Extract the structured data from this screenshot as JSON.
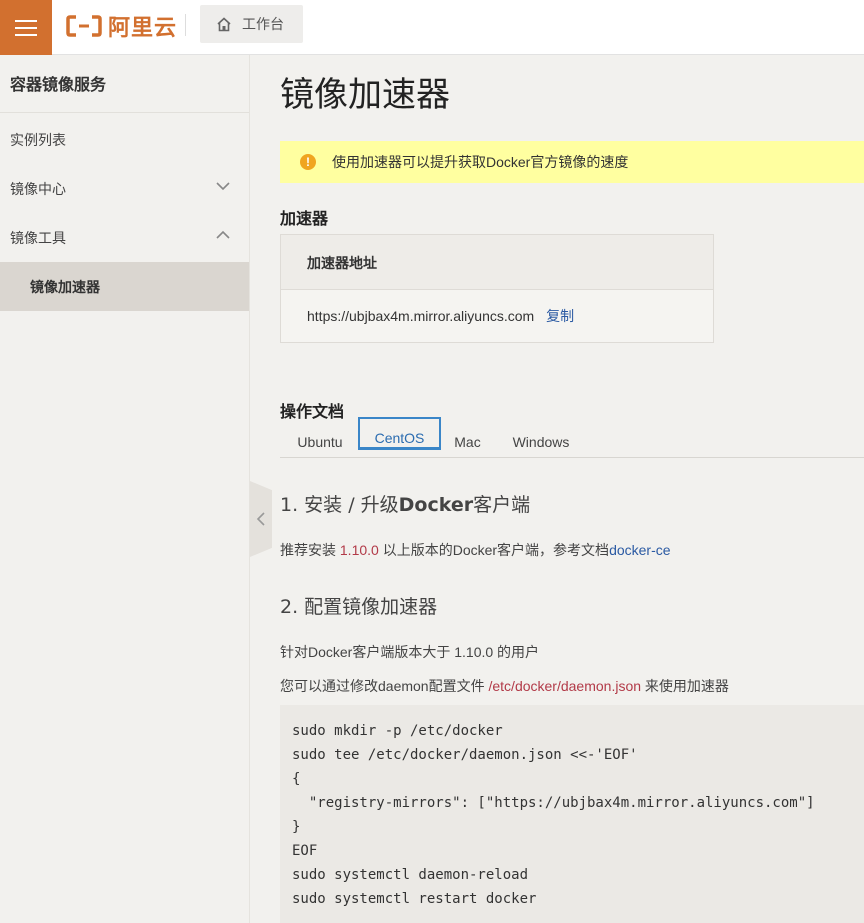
{
  "topbar": {
    "logo_text": "阿里云",
    "workbench_label": "工作台"
  },
  "sidebar": {
    "title": "容器镜像服务",
    "items": [
      {
        "label": "实例列表"
      },
      {
        "label": "镜像中心"
      },
      {
        "label": "镜像工具"
      },
      {
        "label": "镜像加速器"
      }
    ]
  },
  "main": {
    "title": "镜像加速器",
    "notice": "使用加速器可以提升获取Docker官方镜像的速度",
    "accelerator_heading": "加速器",
    "accelerator_table": {
      "header": "加速器地址",
      "address": "https://ubjbax4m.mirror.aliyuncs.com",
      "copy_label": "复制"
    },
    "docs_heading": "操作文档",
    "tabs": [
      "Ubuntu",
      "CentOS",
      "Mac",
      "Windows"
    ],
    "active_tab": "CentOS",
    "step1": {
      "title_prefix": "1. 安装 / 升级",
      "title_bold": "Docker",
      "title_suffix": "客户端",
      "text_before": "推荐安装 ",
      "version": "1.10.0",
      "text_middle": " 以上版本的Docker客户端，参考文档",
      "link": "docker-ce"
    },
    "step2": {
      "title": "2. 配置镜像加速器",
      "line1": "针对Docker客户端版本大于 1.10.0 的用户",
      "line2_before": "您可以通过修改daemon配置文件 ",
      "line2_path": "/etc/docker/daemon.json",
      "line2_after": " 来使用加速器"
    },
    "code_lines": [
      "sudo mkdir -p /etc/docker",
      "sudo tee /etc/docker/daemon.json <<-'EOF'",
      "{",
      "  \"registry-mirrors\": [\"https://ubjbax4m.mirror.aliyuncs.com\"]",
      "}",
      "EOF",
      "sudo systemctl daemon-reload",
      "sudo systemctl restart docker"
    ]
  },
  "colors": {
    "brand": "#d2702f",
    "link": "#2b5aa3",
    "notice_bg": "#ffffa0",
    "tab_active": "#3a86c8"
  }
}
